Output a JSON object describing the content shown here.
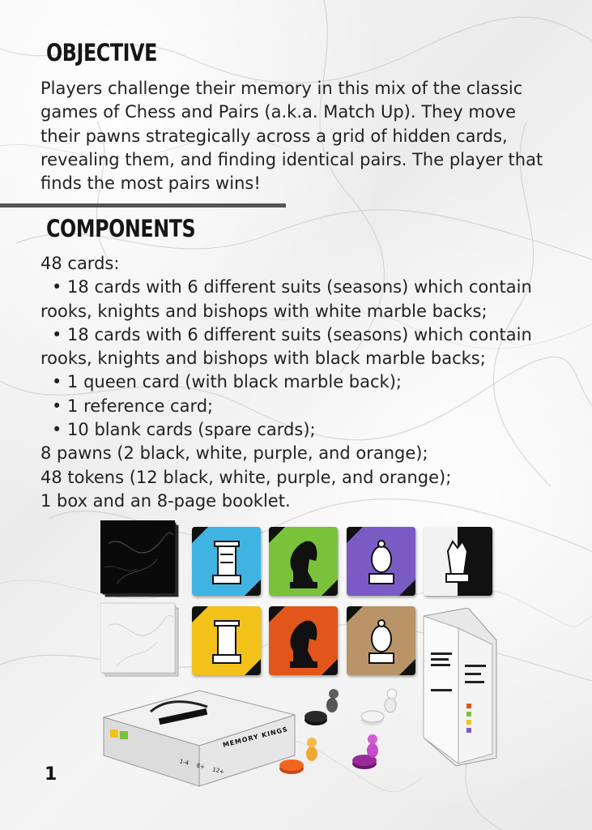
{
  "objective": {
    "title": "Objective",
    "lines": [
      "Players challenge their memory in this mix of the classic",
      "games of Chess and Pairs (a.k.a. Match Up). They move",
      "their pawns strategically across a grid of hidden cards,",
      "revealing them, and finding identical pairs. The player that",
      "finds the most pairs wins!"
    ]
  },
  "components": {
    "title": "Components",
    "lines": [
      {
        "text": "48 cards:",
        "indent": false
      },
      {
        "text": "• 18 cards with 6 different suits (seasons) which contain",
        "indent": true
      },
      {
        "text": "rooks, knights and bishops with white marble backs;",
        "indent": false
      },
      {
        "text": "• 18 cards with 6 different suits (seasons) which contain",
        "indent": true
      },
      {
        "text": "rooks, knights and bishops with black marble backs;",
        "indent": false
      },
      {
        "text": "• 1 queen card (with black marble back);",
        "indent": true
      },
      {
        "text": "• 1 reference card;",
        "indent": true
      },
      {
        "text": "• 10 blank cards (spare cards);",
        "indent": true
      },
      {
        "text": "8 pawns (2 black, white, purple, and orange);",
        "indent": false
      },
      {
        "text": "48 tokens (12 black, white, purple, and orange);",
        "indent": false
      },
      {
        "text": "1 box and an 8-page booklet.",
        "indent": false
      }
    ]
  },
  "page_number": "1",
  "colors": {
    "text": "#222222",
    "divider": "#555555",
    "winter": "#3fb4e3",
    "spring": "#79c23a",
    "purple": "#7a5bc4",
    "summer": "#f2c21a",
    "autumn": "#e2561b",
    "earth": "#b89468"
  },
  "box_label": "MEMORY KINGS",
  "box_badges": [
    "1-4",
    "8+",
    "12+"
  ]
}
